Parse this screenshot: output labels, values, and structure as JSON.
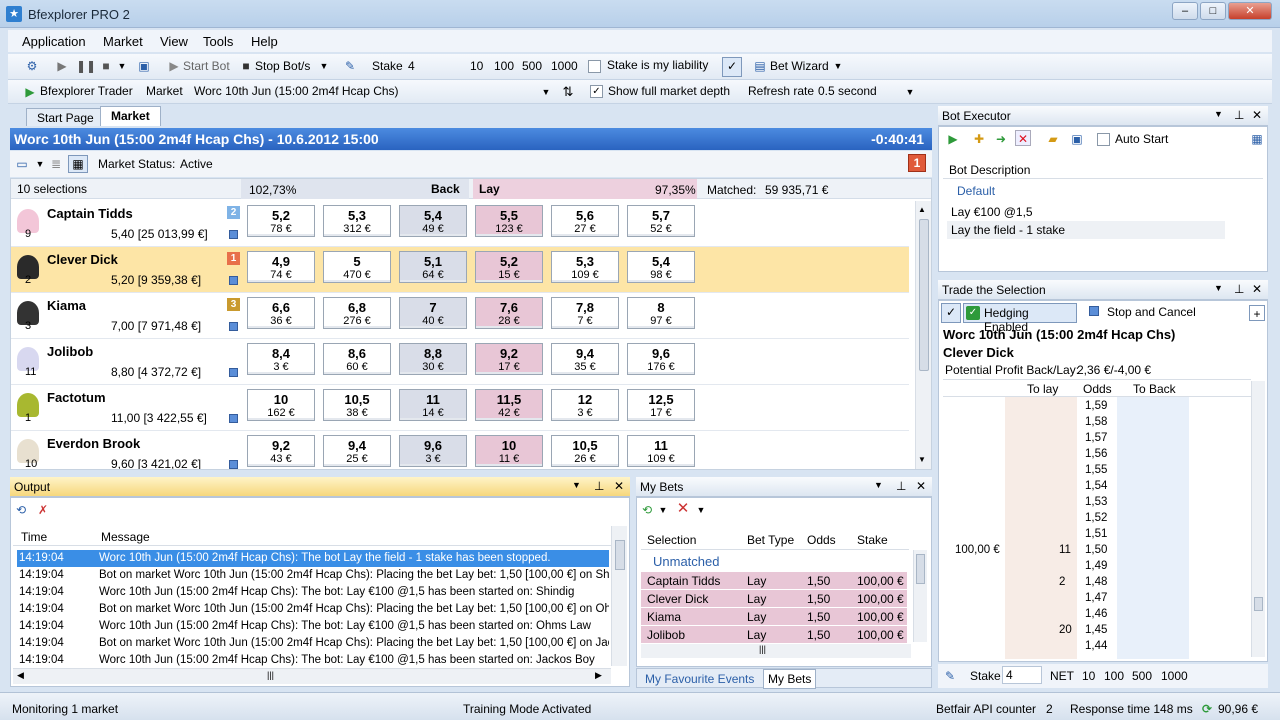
{
  "window": {
    "title": "Bfexplorer PRO 2",
    "minimize": "–",
    "maximize": "□",
    "close": "✕"
  },
  "menu": [
    "Application",
    "Market",
    "View",
    "Tools",
    "Help"
  ],
  "toolbar": {
    "start_bot": "Start Bot",
    "stop_bot": "Stop Bot/s",
    "stake_label": "Stake",
    "stake_value": "4",
    "quick_stakes": [
      "10",
      "100",
      "500",
      "1000"
    ],
    "liability_label": "Stake is my liability",
    "bet_wizard": "Bet Wizard"
  },
  "toolbar2": {
    "trader": "Bfexplorer Trader",
    "market_label": "Market",
    "market_value": "Worc 10th Jun (15:00 2m4f Hcap Chs)",
    "full_depth_label": "Show full market depth",
    "refresh_label": "Refresh rate",
    "refresh_value": "0.5 second"
  },
  "tabs": [
    "Start Page",
    "Market"
  ],
  "market": {
    "title": "Worc 10th Jun (15:00 2m4f Hcap Chs) - 10.6.2012 15:00",
    "countdown": "-0:40:41",
    "status_label": "Market Status:",
    "status_value": "Active",
    "badge": "1",
    "selections": "10 selections",
    "back_pct": "102,73%",
    "back_label": "Back",
    "lay_label": "Lay",
    "lay_pct": "97,35%",
    "matched_label": "Matched:",
    "matched_value": "59 935,71 €",
    "runners": [
      {
        "name": "Captain Tidds",
        "num": "9",
        "last": "5,40 [25 013,99 €]",
        "rank": "2",
        "rank_color": "#7fb3e6",
        "prices": [
          [
            "5,2",
            "78 €"
          ],
          [
            "5,3",
            "312 €"
          ],
          [
            "5,4",
            "49 €"
          ],
          [
            "5,5",
            "123 €"
          ],
          [
            "5,6",
            "27 €"
          ],
          [
            "5,7",
            "52 €"
          ]
        ]
      },
      {
        "name": "Clever Dick",
        "num": "2",
        "last": "5,20 [9 359,38 €]",
        "rank": "1",
        "rank_color": "#e8704a",
        "prices": [
          [
            "4,9",
            "74 €"
          ],
          [
            "5",
            "470 €"
          ],
          [
            "5,1",
            "64 €"
          ],
          [
            "5,2",
            "15 €"
          ],
          [
            "5,3",
            "109 €"
          ],
          [
            "5,4",
            "98 €"
          ]
        ]
      },
      {
        "name": "Kiama",
        "num": "3",
        "last": "7,00 [7 971,48 €]",
        "rank": "3",
        "rank_color": "#c99a2e",
        "prices": [
          [
            "6,6",
            "36 €"
          ],
          [
            "6,8",
            "276 €"
          ],
          [
            "7",
            "40 €"
          ],
          [
            "7,6",
            "28 €"
          ],
          [
            "7,8",
            "7 €"
          ],
          [
            "8",
            "97 €"
          ]
        ]
      },
      {
        "name": "Jolibob",
        "num": "11",
        "last": "8,80 [4 372,72 €]",
        "rank": "",
        "rank_color": "",
        "prices": [
          [
            "8,4",
            "3 €"
          ],
          [
            "8,6",
            "60 €"
          ],
          [
            "8,8",
            "30 €"
          ],
          [
            "9,2",
            "17 €"
          ],
          [
            "9,4",
            "35 €"
          ],
          [
            "9,6",
            "176 €"
          ]
        ]
      },
      {
        "name": "Factotum",
        "num": "1",
        "last": "11,00 [3 422,55 €]",
        "rank": "",
        "rank_color": "",
        "prices": [
          [
            "10",
            "162 €"
          ],
          [
            "10,5",
            "38 €"
          ],
          [
            "11",
            "14 €"
          ],
          [
            "11,5",
            "42 €"
          ],
          [
            "12",
            "3 €"
          ],
          [
            "12,5",
            "17 €"
          ]
        ]
      },
      {
        "name": "Everdon Brook",
        "num": "10",
        "last": "9,60 [3 421,02 €]",
        "rank": "",
        "rank_color": "",
        "prices": [
          [
            "9,2",
            "43 €"
          ],
          [
            "9,4",
            "25 €"
          ],
          [
            "9,6",
            "3 €"
          ],
          [
            "10",
            "11 €"
          ],
          [
            "10,5",
            "26 €"
          ],
          [
            "11",
            "109 €"
          ]
        ]
      }
    ]
  },
  "output": {
    "title": "Output",
    "col_time": "Time",
    "col_message": "Message",
    "rows": [
      {
        "time": "14:19:04",
        "msg": "Worc 10th Jun (15:00 2m4f Hcap Chs): The bot Lay the field - 1 stake has been stopped."
      },
      {
        "time": "14:19:04",
        "msg": "Bot on market Worc 10th Jun (15:00 2m4f Hcap Chs): Placing the bet Lay bet: 1,50 [100,00 €] on Shindig"
      },
      {
        "time": "14:19:04",
        "msg": "Worc 10th Jun (15:00 2m4f Hcap Chs): The bot: Lay €100 @1,5 has been started on: Shindig"
      },
      {
        "time": "14:19:04",
        "msg": "Bot on market Worc 10th Jun (15:00 2m4f Hcap Chs): Placing the bet Lay bet: 1,50 [100,00 €] on Ohms Law"
      },
      {
        "time": "14:19:04",
        "msg": "Worc 10th Jun (15:00 2m4f Hcap Chs): The bot: Lay €100 @1,5 has been started on: Ohms Law"
      },
      {
        "time": "14:19:04",
        "msg": "Bot on market Worc 10th Jun (15:00 2m4f Hcap Chs): Placing the bet Lay bet: 1,50 [100,00 €] on Jackos Boy"
      },
      {
        "time": "14:19:04",
        "msg": "Worc 10th Jun (15:00 2m4f Hcap Chs): The bot: Lay €100 @1,5 has been started on: Jackos Boy"
      }
    ]
  },
  "mybets": {
    "title": "My Bets",
    "cols": [
      "Selection",
      "Bet Type",
      "Odds",
      "Stake"
    ],
    "group": "Unmatched",
    "rows": [
      {
        "sel": "Captain Tidds",
        "type": "Lay",
        "odds": "1,50",
        "stake": "100,00 €"
      },
      {
        "sel": "Clever Dick",
        "type": "Lay",
        "odds": "1,50",
        "stake": "100,00 €"
      },
      {
        "sel": "Kiama",
        "type": "Lay",
        "odds": "1,50",
        "stake": "100,00 €"
      },
      {
        "sel": "Jolibob",
        "type": "Lay",
        "odds": "1,50",
        "stake": "100,00 €"
      }
    ],
    "tab1": "My Favourite Events",
    "tab2": "My Bets"
  },
  "bot_executor": {
    "title": "Bot Executor",
    "auto_start": "Auto Start",
    "col": "Bot Description",
    "group": "Default",
    "items": [
      "Lay €100 @1,5",
      "Lay the field - 1 stake"
    ]
  },
  "trade": {
    "title": "Trade the Selection",
    "hedging": "Hedging Enabled",
    "stop_cancel": "Stop and Cancel",
    "market": "Worc 10th Jun (15:00 2m4f Hcap Chs)",
    "selection": "Clever Dick",
    "profit_label": "Potential Profit Back/Lay:",
    "profit_value": "2,36 €/-4,00 €",
    "cols": [
      "To lay",
      "Odds",
      "To Back"
    ],
    "ladder": [
      {
        "left": "",
        "tolay": "",
        "odds": "1,59"
      },
      {
        "left": "",
        "tolay": "",
        "odds": "1,58"
      },
      {
        "left": "",
        "tolay": "",
        "odds": "1,57"
      },
      {
        "left": "",
        "tolay": "",
        "odds": "1,56"
      },
      {
        "left": "",
        "tolay": "",
        "odds": "1,55"
      },
      {
        "left": "",
        "tolay": "",
        "odds": "1,54"
      },
      {
        "left": "",
        "tolay": "",
        "odds": "1,53"
      },
      {
        "left": "",
        "tolay": "",
        "odds": "1,52"
      },
      {
        "left": "",
        "tolay": "",
        "odds": "1,51"
      },
      {
        "left": "100,00 €",
        "tolay": "11",
        "odds": "1,50"
      },
      {
        "left": "",
        "tolay": "",
        "odds": "1,49"
      },
      {
        "left": "",
        "tolay": "2",
        "odds": "1,48"
      },
      {
        "left": "",
        "tolay": "",
        "odds": "1,47"
      },
      {
        "left": "",
        "tolay": "",
        "odds": "1,46"
      },
      {
        "left": "",
        "tolay": "20",
        "odds": "1,45"
      },
      {
        "left": "",
        "tolay": "",
        "odds": "1,44"
      }
    ],
    "stake_label": "Stake",
    "stake_value": "4",
    "net": "NET",
    "quick": [
      "10",
      "100",
      "500",
      "1000"
    ]
  },
  "status": {
    "monitoring": "Monitoring 1 market",
    "training": "Training Mode Activated",
    "api_label": "Betfair API counter",
    "api_value": "2",
    "response": "Response time 148 ms",
    "balance": "90,96 €"
  }
}
